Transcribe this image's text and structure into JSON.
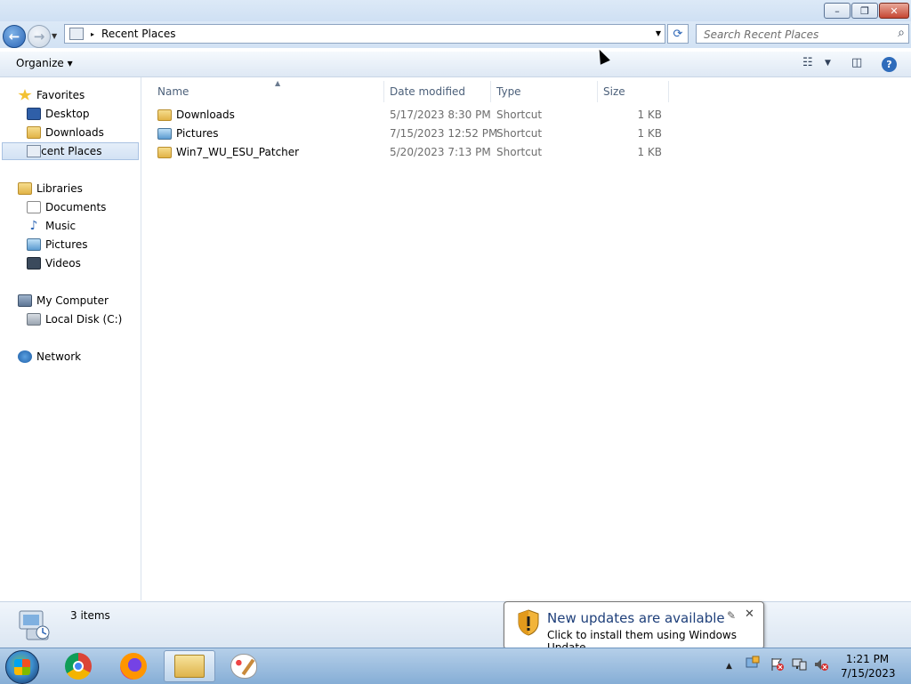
{
  "window": {
    "controls": {
      "minimize": "–",
      "maximize": "❐",
      "close": "✕"
    }
  },
  "navigation": {
    "address": {
      "arrow": "▸",
      "location": "Recent Places"
    },
    "search": {
      "placeholder": "Search Recent Places",
      "value": ""
    }
  },
  "toolbar": {
    "organize_label": "Organize ▾"
  },
  "sidebar": {
    "favorites": {
      "label": "Favorites",
      "items": [
        {
          "label": "Desktop",
          "icon": "desktop-icon"
        },
        {
          "label": "Downloads",
          "icon": "downloads-folder-icon"
        },
        {
          "label": "Recent Places",
          "icon": "recent-places-icon",
          "selected": true
        }
      ]
    },
    "libraries": {
      "label": "Libraries",
      "items": [
        {
          "label": "Documents",
          "icon": "documents-icon"
        },
        {
          "label": "Music",
          "icon": "music-icon"
        },
        {
          "label": "Pictures",
          "icon": "pictures-icon"
        },
        {
          "label": "Videos",
          "icon": "videos-icon"
        }
      ]
    },
    "computer": {
      "label": "My Computer",
      "items": [
        {
          "label": "Local Disk (C:)",
          "icon": "local-disk-icon"
        }
      ]
    },
    "network": {
      "label": "Network"
    }
  },
  "file_list": {
    "columns": [
      "Name",
      "Date modified",
      "Type",
      "Size"
    ],
    "rows": [
      {
        "name": "Downloads",
        "date": "5/17/2023 8:30 PM",
        "type": "Shortcut",
        "size": "1 KB",
        "icon": "folder-shortcut-icon"
      },
      {
        "name": "Pictures",
        "date": "7/15/2023 12:52 PM",
        "type": "Shortcut",
        "size": "1 KB",
        "icon": "pictures-shortcut-icon"
      },
      {
        "name": "Win7_WU_ESU_Patcher",
        "date": "5/20/2023 7:13 PM",
        "type": "Shortcut",
        "size": "1 KB",
        "icon": "folder-shortcut-icon"
      }
    ]
  },
  "status_bar": {
    "item_count": "3 items"
  },
  "notification": {
    "title": "New updates are available",
    "message": "Click to install them using Windows Update.",
    "close": "✕"
  },
  "taskbar": {
    "apps": [
      "Google Chrome",
      "Firefox",
      "Windows Explorer",
      "Paint"
    ],
    "tray_arrow": "▲",
    "clock": {
      "time": "1:21 PM",
      "date": "7/15/2023"
    }
  },
  "colors": {
    "accent": "#2a64b5",
    "titlebar": "#dce9f7",
    "notification_title": "#1e3f7a"
  }
}
